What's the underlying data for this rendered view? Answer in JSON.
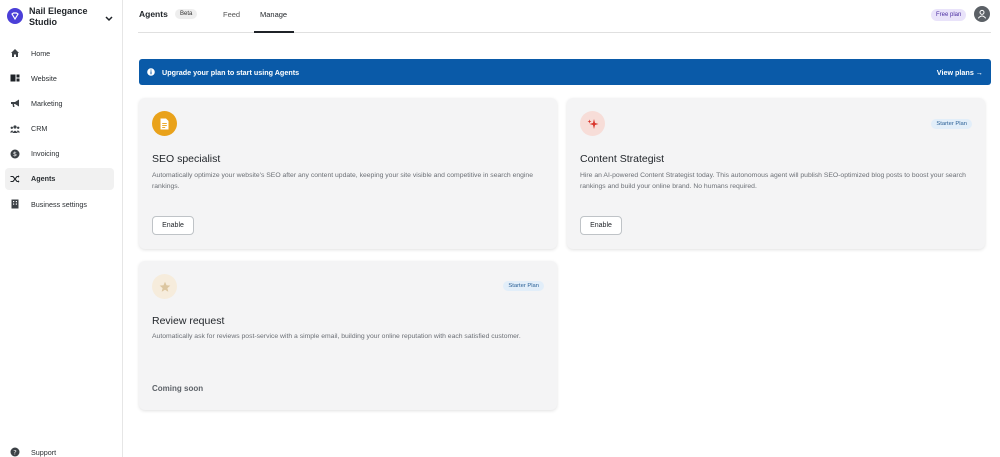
{
  "sidebar": {
    "brand": "Nail Elegance Studio",
    "items": [
      {
        "label": "Home",
        "icon": "home-icon"
      },
      {
        "label": "Website",
        "icon": "website-icon"
      },
      {
        "label": "Marketing",
        "icon": "megaphone-icon"
      },
      {
        "label": "CRM",
        "icon": "people-icon"
      },
      {
        "label": "Invoicing",
        "icon": "dollar-icon"
      },
      {
        "label": "Agents",
        "icon": "shuffle-icon",
        "active": true
      },
      {
        "label": "Business settings",
        "icon": "building-icon"
      }
    ],
    "support": "Support"
  },
  "header": {
    "title": "Agents",
    "beta": "Beta",
    "tabs": [
      "Feed",
      "Manage"
    ],
    "active_tab": "Manage",
    "plan_badge": "Free plan"
  },
  "banner": {
    "text": "Upgrade your plan to start using Agents",
    "link": "View plans →",
    "color": "#0a5aa8"
  },
  "cards": [
    {
      "title": "SEO specialist",
      "description": "Automatically optimize your website's SEO after any content update, keeping your site visible and competitive in search engine rankings.",
      "action": "Enable",
      "icon": "document-icon"
    },
    {
      "title": "Content Strategist",
      "description": "Hire an AI-powered Content Strategist today. This autonomous agent will publish SEO-optimized blog posts to boost your search rankings and build your online brand. No humans required.",
      "action": "Enable",
      "badge": "Starter Plan",
      "icon": "sparkle-icon"
    },
    {
      "title": "Review request",
      "description": "Automatically ask for reviews post-service with a simple email, building your online reputation with each satisfied customer.",
      "status": "Coming soon",
      "badge": "Starter Plan",
      "icon": "star-icon"
    }
  ]
}
